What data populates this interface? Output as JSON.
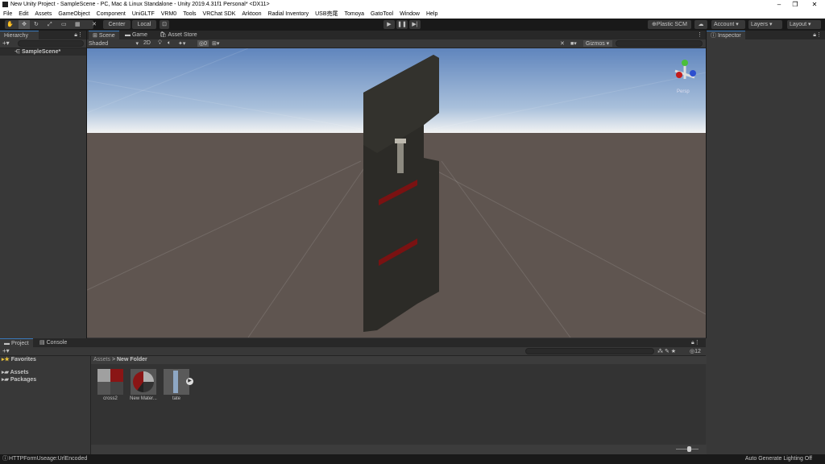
{
  "window": {
    "title": "New Unity Project - SampleScene - PC, Mac & Linux Standalone - Unity 2019.4.31f1 Personal* <DX11>",
    "minimize": "–",
    "restore": "❐",
    "close": "✕"
  },
  "menu": [
    "File",
    "Edit",
    "Assets",
    "GameObject",
    "Component",
    "UniGLTF",
    "VRM0",
    "Tools",
    "VRChat SDK",
    "Arktoon",
    "Radial Inventory",
    "USB売尾",
    "Tomoya",
    "GatoTool",
    "Window",
    "Help"
  ],
  "toolbar": {
    "center": "Center",
    "local": "Local",
    "plastic": "⊕Plastic SCM",
    "account": "Account",
    "layers": "Layers",
    "layout": "Layout",
    "tools": [
      "hand",
      "move",
      "rotate",
      "scale",
      "rect",
      "transform",
      "custom"
    ]
  },
  "hierarchy": {
    "tab": "Hierarchy",
    "add": "+▾",
    "scene": "SampleScene*"
  },
  "scene": {
    "tabs": [
      "Scene",
      "Game",
      "Asset Store"
    ],
    "shading": "Shaded",
    "mode2d": "2D",
    "gizmos": "Gizmos",
    "hidden_count": "0",
    "persp": "Persp"
  },
  "inspector": {
    "tab": "Inspector"
  },
  "project": {
    "tabs": [
      "Project",
      "Console"
    ],
    "add": "+▾",
    "favorites": "Favorites",
    "tree": [
      "Assets",
      "Packages"
    ],
    "breadcrumb": [
      "Assets",
      "New Folder"
    ],
    "assets": [
      {
        "name": "cross2"
      },
      {
        "name": "New Mater..."
      },
      {
        "name": "tate"
      }
    ],
    "badge": "12"
  },
  "status": {
    "message": "HTTPFormUseage:UrlEncoded",
    "lighting": "Auto Generate Lighting Off"
  },
  "colors": {
    "accent": "#3a79bb",
    "panel": "#383838",
    "sky": "#6389c0",
    "ground": "#5f5550"
  }
}
